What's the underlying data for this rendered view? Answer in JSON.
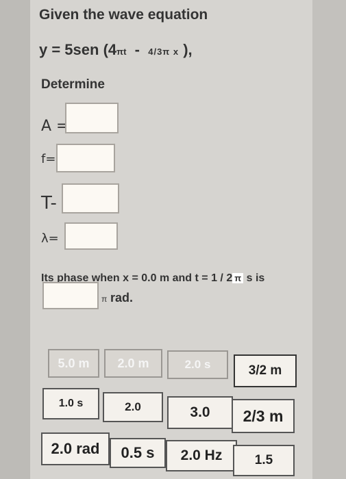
{
  "question": {
    "title": "Given the wave equation",
    "equation": {
      "lhs": "y = 5sen",
      "open": "(4",
      "pi_t": "πt",
      "minus": "-",
      "k": "4/3π x",
      "close": "),"
    },
    "determine": "Determine",
    "fields": [
      {
        "label": "A =",
        "value": ""
      },
      {
        "label": "f=",
        "value": ""
      },
      {
        "label": "T-",
        "value": ""
      },
      {
        "label": "λ=",
        "value": ""
      }
    ],
    "phase_text_a": "Its phase when x = 0.0 m and t = 1 / 2",
    "phase_pi": "π",
    "phase_text_b": "s is",
    "phase_value": "",
    "phase_unit_pi": "π",
    "phase_unit": "rad."
  },
  "answers": [
    "5.0 m",
    "2.0 m",
    "2.0 s",
    "3/2 m",
    "1.0 s",
    "2.0",
    "3.0",
    "2/3 m",
    "2.0 rad",
    "0.5 s",
    "2.0 Hz",
    "1.5"
  ],
  "colors": {
    "background": "#d6d4d0",
    "input_box": "#fcf9f3",
    "chip": "#f4f1ec"
  }
}
